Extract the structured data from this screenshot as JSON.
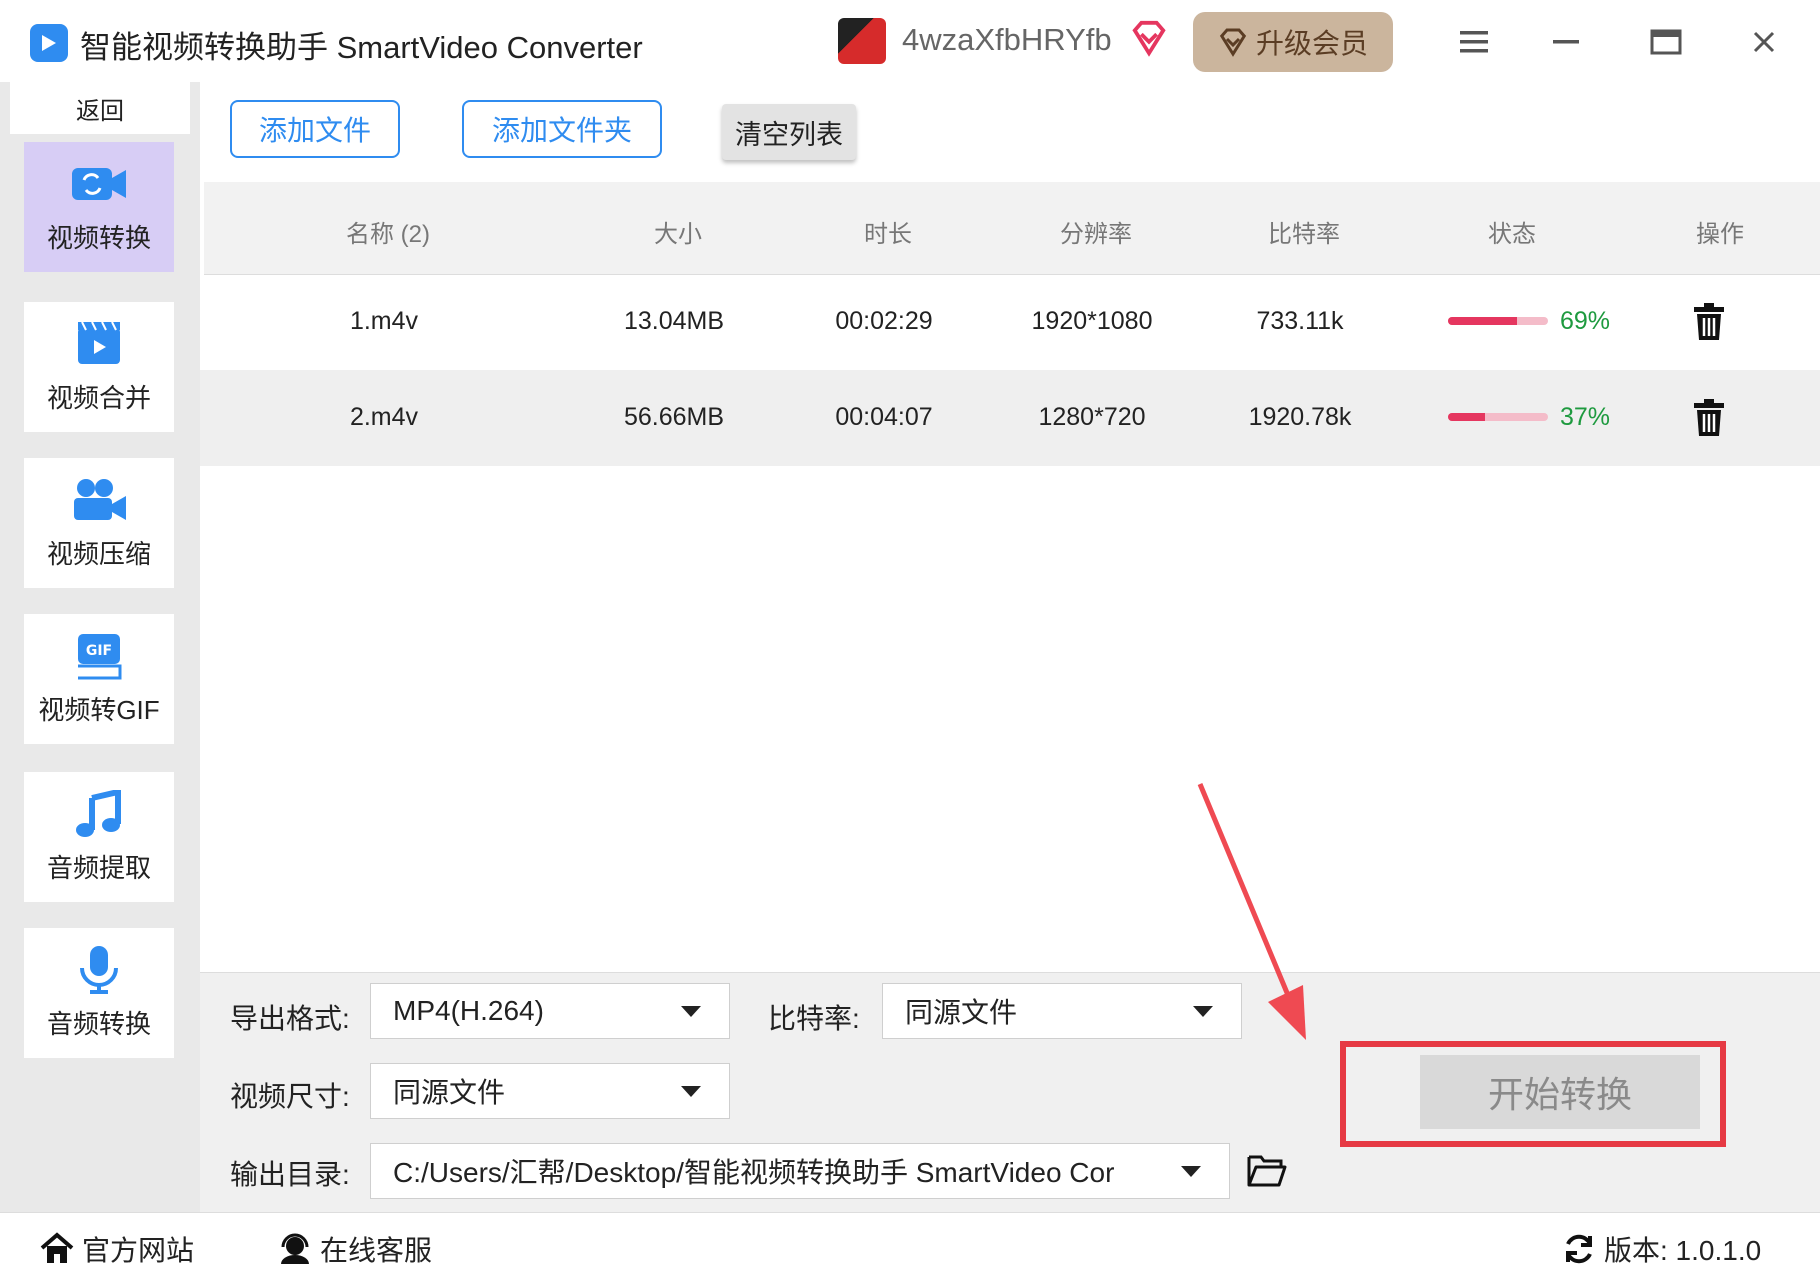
{
  "app": {
    "title": "智能视频转换助手 SmartVideo Converter",
    "username": "4wzaXfbHRYfb",
    "upgrade_label": "升级会员"
  },
  "sidebar": {
    "back_label": "返回",
    "items": [
      {
        "label": "视频转换",
        "icon": "video-convert-icon",
        "active": true
      },
      {
        "label": "视频合并",
        "icon": "video-merge-icon"
      },
      {
        "label": "视频压缩",
        "icon": "video-compress-icon"
      },
      {
        "label": "视频转GIF",
        "icon": "gif-icon"
      },
      {
        "label": "音频提取",
        "icon": "music-note-icon"
      },
      {
        "label": "音频转换",
        "icon": "microphone-icon"
      }
    ]
  },
  "toolbar": {
    "add_file": "添加文件",
    "add_folder": "添加文件夹",
    "clear_list": "清空列表"
  },
  "table": {
    "headers": [
      "名称 (2)",
      "大小",
      "时长",
      "分辨率",
      "比特率",
      "状态",
      "操作"
    ],
    "rows": [
      {
        "name": "1.m4v",
        "size": "13.04MB",
        "duration": "00:02:29",
        "resolution": "1920*1080",
        "bitrate": "733.11k",
        "progress": 69,
        "progress_label": "69%"
      },
      {
        "name": "2.m4v",
        "size": "56.66MB",
        "duration": "00:04:07",
        "resolution": "1280*720",
        "bitrate": "1920.78k",
        "progress": 37,
        "progress_label": "37%"
      }
    ]
  },
  "settings": {
    "format_label": "导出格式:",
    "format_value": "MP4(H.264)",
    "bitrate_label": "比特率:",
    "bitrate_value": "同源文件",
    "size_label": "视频尺寸:",
    "size_value": "同源文件",
    "output_label": "输出目录:",
    "output_value": "C:/Users/汇帮/Desktop/智能视频转换助手 SmartVideo Cor",
    "start_label": "开始转换"
  },
  "footer": {
    "website": "官方网站",
    "support": "在线客服",
    "version": "版本: 1.0.1.0"
  },
  "colors": {
    "accent": "#2f8cf0",
    "active_sidebar": "#d7cdf5",
    "progress": "#e5365f",
    "progress_track": "#f4bcc9",
    "percent": "#1e9a3f",
    "highlight": "#e63a44"
  }
}
